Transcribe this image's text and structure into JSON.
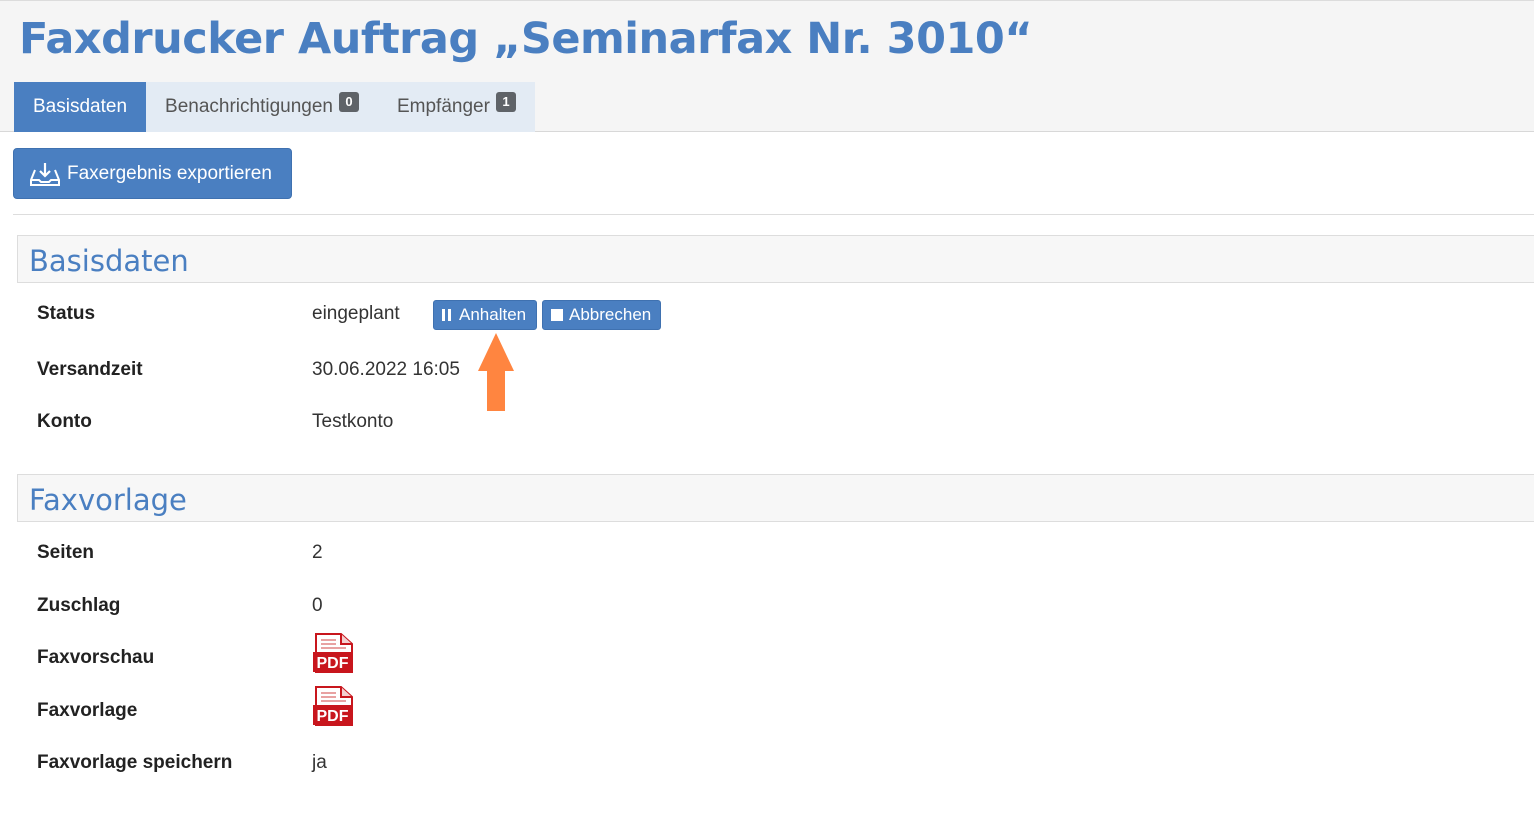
{
  "header": {
    "title": "Faxdrucker Auftrag „Seminarfax Nr. 3010“"
  },
  "tabs": [
    {
      "label": "Basisdaten",
      "badge": "",
      "active": true
    },
    {
      "label": "Benachrichtigungen",
      "badge": "0",
      "active": false
    },
    {
      "label": "Empfänger",
      "badge": "1",
      "active": false
    }
  ],
  "toolbar": {
    "export_label": "Faxergebnis exportieren",
    "export_icon": "download-tray-icon"
  },
  "basisdaten": {
    "title": "Basisdaten",
    "status_label": "Status",
    "status_value": "eingeplant",
    "pause_label": "Anhalten",
    "cancel_label": "Abbrechen",
    "versandzeit_label": "Versandzeit",
    "versandzeit_value": "30.06.2022 16:05",
    "konto_label": "Konto",
    "konto_value": "Testkonto"
  },
  "faxvorlage": {
    "title": "Faxvorlage",
    "seiten_label": "Seiten",
    "seiten_value": "2",
    "zuschlag_label": "Zuschlag",
    "zuschlag_value": "0",
    "vorschau_label": "Faxvorschau",
    "vorlage_label": "Faxvorlage",
    "pdf_text": "PDF",
    "speichern_label": "Faxvorlage speichern",
    "speichern_value": "ja"
  },
  "colors": {
    "accent": "#4a7fc1",
    "arrow": "#ff8540",
    "pdf_red": "#c8161d"
  }
}
